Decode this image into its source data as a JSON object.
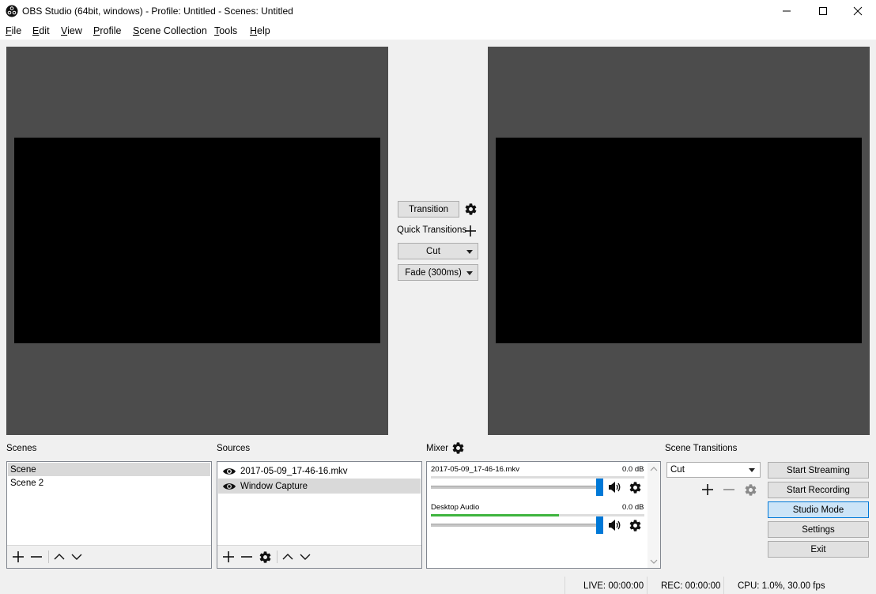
{
  "window": {
    "title": "OBS Studio (64bit, windows) - Profile: Untitled - Scenes: Untitled"
  },
  "menu": [
    {
      "ul": "F",
      "rest": "ile"
    },
    {
      "ul": "E",
      "rest": "dit"
    },
    {
      "ul": "V",
      "rest": "iew"
    },
    {
      "ul": "P",
      "rest": "rofile"
    },
    {
      "ul": "S",
      "rest": "cene Collection"
    },
    {
      "ul": "T",
      "rest": "ools"
    },
    {
      "ul": "H",
      "rest": "elp"
    }
  ],
  "transition_panel": {
    "transition_label": "Transition",
    "quick_transitions_label": "Quick Transitions",
    "quick_items": [
      "Cut",
      "Fade (300ms)"
    ]
  },
  "scenes": {
    "label": "Scenes",
    "items": [
      "Scene",
      "Scene 2"
    ],
    "selected_index": 0
  },
  "sources": {
    "label": "Sources",
    "items": [
      "2017-05-09_17-46-16.mkv",
      "Window Capture"
    ],
    "selected_index": 1
  },
  "mixer": {
    "label": "Mixer",
    "channels": [
      {
        "name": "2017-05-09_17-46-16.mkv",
        "db": "0.0 dB",
        "level": 0.0,
        "volume": 1.0
      },
      {
        "name": "Desktop Audio",
        "db": "0.0 dB",
        "level": 0.6,
        "volume": 1.0
      }
    ]
  },
  "scene_transitions": {
    "label": "Scene Transitions",
    "selected": "Cut"
  },
  "controls": {
    "start_streaming": "Start Streaming",
    "start_recording": "Start Recording",
    "studio_mode": "Studio Mode",
    "settings": "Settings",
    "exit": "Exit"
  },
  "status": {
    "live": "LIVE: 00:00:00",
    "rec": "REC: 00:00:00",
    "cpu": "CPU: 1.0%, 30.00 fps"
  },
  "colors": {
    "preview_bg": "#4c4c4c",
    "meter_green": "#3fb43f",
    "slider_blue": "#0078d7",
    "active_button": "#cce4f7"
  }
}
